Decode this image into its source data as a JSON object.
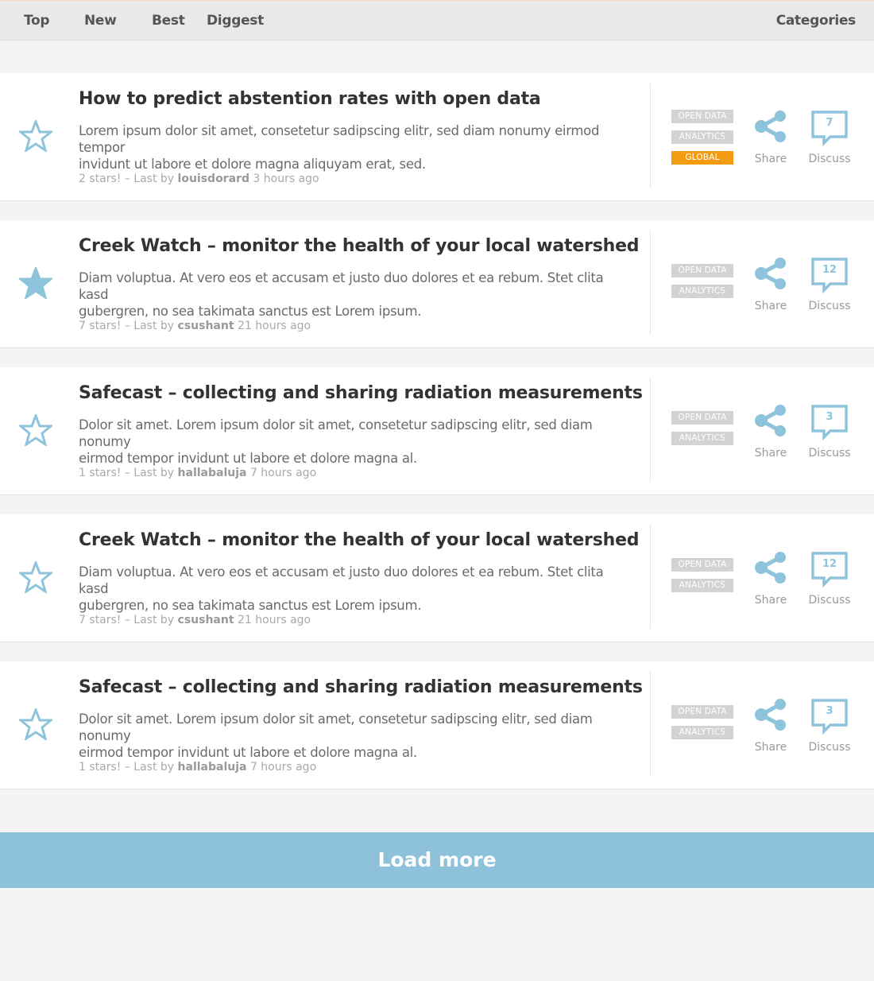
{
  "nav": {
    "top": "Top",
    "new": "New",
    "best": "Best",
    "diggest": "Diggest",
    "categories": "Categories"
  },
  "posts": [
    {
      "title": "How to predict abstention rates with open data",
      "description_line1": "Lorem ipsum dolor sit amet, consetetur sadipscing elitr, sed diam nonumy eirmod tempor",
      "description_line2": "invidunt ut labore et dolore magna aliquyam erat, sed.",
      "meta_prefix": "2 stars! – Last by",
      "user": "louisdorard",
      "time": "3 hours ago",
      "starred": false,
      "tags": [
        "OPEN DATA",
        "ANALYTICS",
        "GLOBAL"
      ],
      "share_label": "Share",
      "discuss_label": "Discuss",
      "comments": "7"
    },
    {
      "title": "Creek Watch – monitor the health of your local watershed",
      "description_line1": "Diam voluptua. At vero eos et accusam et justo duo dolores et ea rebum. Stet clita kasd",
      "description_line2": "gubergren, no sea takimata sanctus est Lorem ipsum.",
      "meta_prefix": "7 stars! – Last by",
      "user": "csushant",
      "time": "21 hours ago",
      "starred": true,
      "tags": [
        "OPEN DATA",
        "ANALYTICS"
      ],
      "share_label": "Share",
      "discuss_label": "Discuss",
      "comments": "12"
    },
    {
      "title": "Safecast – collecting and sharing radiation measurements",
      "description_line1": "Dolor sit amet. Lorem ipsum dolor sit amet, consetetur sadipscing elitr, sed diam nonumy",
      "description_line2": "eirmod tempor invidunt ut labore et dolore magna al.",
      "meta_prefix": "1 stars! – Last by",
      "user": "hallabaluja",
      "time": "7 hours ago",
      "starred": false,
      "tags": [
        "OPEN DATA",
        "ANALYTICS"
      ],
      "share_label": "Share",
      "discuss_label": "Discuss",
      "comments": "3"
    },
    {
      "title": "Creek Watch – monitor the health of your local watershed",
      "description_line1": "Diam voluptua. At vero eos et accusam et justo duo dolores et ea rebum. Stet clita kasd",
      "description_line2": "gubergren, no sea takimata sanctus est Lorem ipsum.",
      "meta_prefix": "7 stars! – Last by",
      "user": "csushant",
      "time": "21 hours ago",
      "starred": false,
      "tags": [
        "OPEN DATA",
        "ANALYTICS"
      ],
      "share_label": "Share",
      "discuss_label": "Discuss",
      "comments": "12"
    },
    {
      "title": "Safecast – collecting and sharing radiation measurements",
      "description_line1": "Dolor sit amet. Lorem ipsum dolor sit amet, consetetur sadipscing elitr, sed diam nonumy",
      "description_line2": "eirmod tempor invidunt ut labore et dolore magna al.",
      "meta_prefix": "1 stars! – Last by",
      "user": "hallabaluja",
      "time": "7 hours ago",
      "starred": false,
      "tags": [
        "OPEN DATA",
        "ANALYTICS"
      ],
      "share_label": "Share",
      "discuss_label": "Discuss",
      "comments": "3"
    }
  ],
  "load_more": "Load more",
  "colors": {
    "accent": "#8dc2da",
    "tag": "#d3d3d3",
    "tag_global": "#f39c12",
    "icon": "#8ec3dc"
  }
}
